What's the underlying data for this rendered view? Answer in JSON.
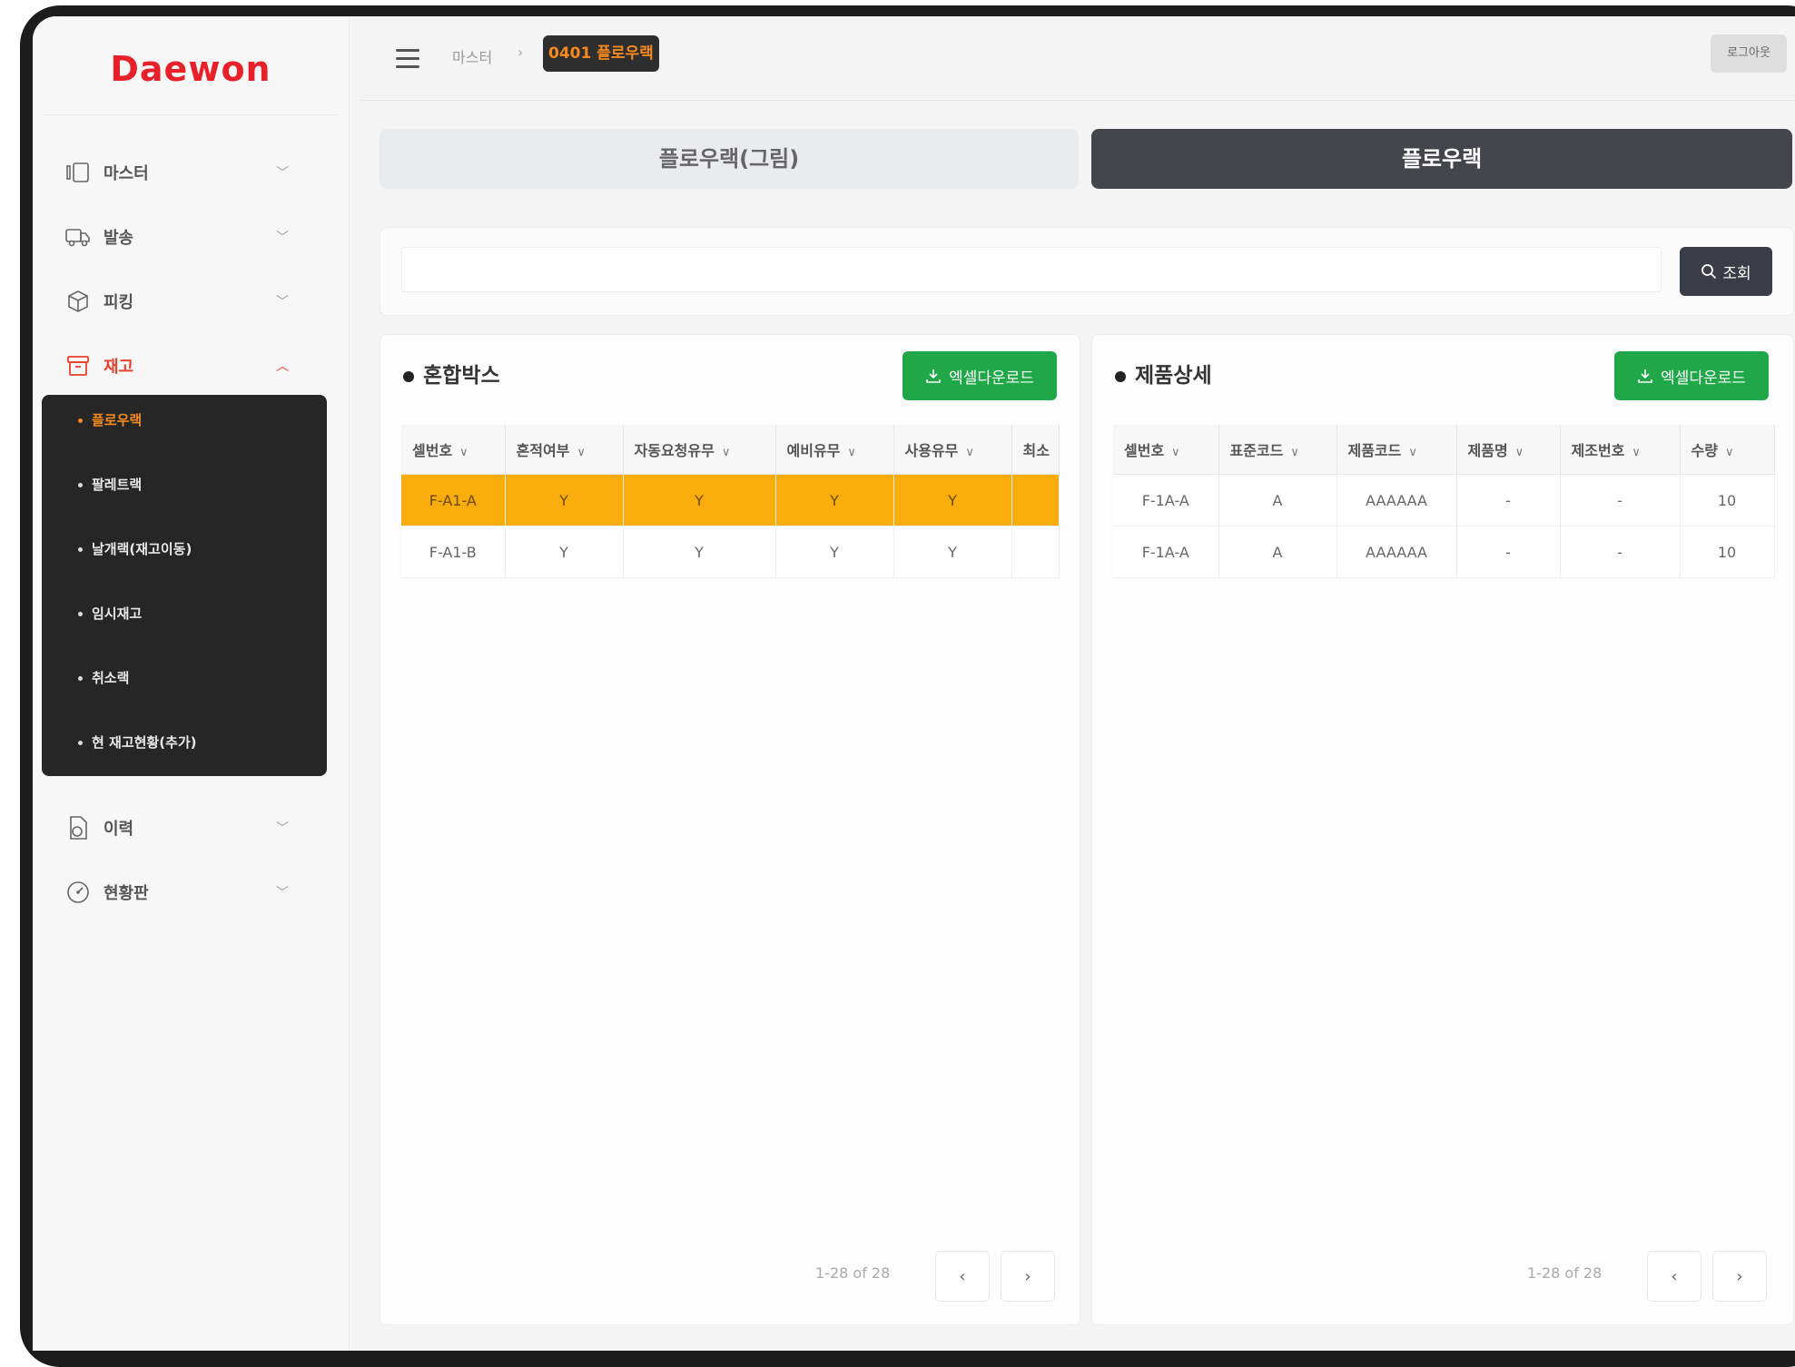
{
  "brand": {
    "logo": "Daewon"
  },
  "sidebar": {
    "items": [
      {
        "label": "마스터",
        "icon": "layout-icon"
      },
      {
        "label": "발송",
        "icon": "truck-icon"
      },
      {
        "label": "피킹",
        "icon": "box-icon"
      },
      {
        "label": "재고",
        "icon": "inventory-icon"
      },
      {
        "label": "이력",
        "icon": "history-icon"
      },
      {
        "label": "현황판",
        "icon": "gauge-icon"
      }
    ],
    "submenu": [
      {
        "label": "플로우랙"
      },
      {
        "label": "팔레트랙"
      },
      {
        "label": "날개랙(재고이동)"
      },
      {
        "label": "임시재고"
      },
      {
        "label": "취소랙"
      },
      {
        "label": "현 재고현황(추가)"
      }
    ]
  },
  "topbar": {
    "breadcrumb_parent": "마스터",
    "breadcrumb_current": "0401 플로우랙",
    "logout_label": "로그아웃"
  },
  "tabs": {
    "inactive": "플로우랙(그림)",
    "active": "플로우랙"
  },
  "search": {
    "value": "",
    "placeholder": "",
    "button_label": "조회"
  },
  "mixed_box": {
    "title": "혼합박스",
    "excel_label": "엑셀다운로드",
    "columns": [
      "셀번호",
      "혼적여부",
      "자동요청유무",
      "예비유무",
      "사용유무",
      "최소"
    ],
    "rows": [
      [
        "F-A1-A",
        "Y",
        "Y",
        "Y",
        "Y",
        ""
      ],
      [
        "F-A1-B",
        "Y",
        "Y",
        "Y",
        "Y",
        ""
      ]
    ],
    "pagination": "1-28 of 28"
  },
  "product_detail": {
    "title": "제품상세",
    "excel_label": "엑셀다운로드",
    "columns": [
      "셀번호",
      "표준코드",
      "제품코드",
      "제품명",
      "제조번호",
      "수량"
    ],
    "rows": [
      [
        "F-1A-A",
        "A",
        "AAAAAA",
        "-",
        "-",
        "10"
      ],
      [
        "F-1A-A",
        "A",
        "AAAAAA",
        "-",
        "-",
        "10"
      ]
    ],
    "pagination": "1-28 of 28"
  },
  "colors": {
    "brand_red": "#e6212a",
    "active_orange": "#f58a1f",
    "selected_row": "#f8ad0d",
    "excel_green": "#1fa748",
    "dark_tab": "#45464b",
    "submenu_bg": "#262626"
  }
}
